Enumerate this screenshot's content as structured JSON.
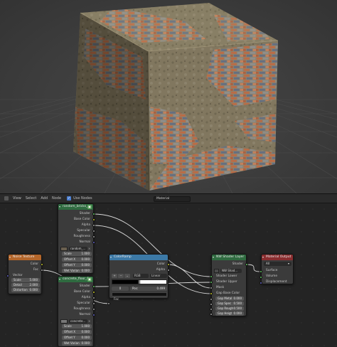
{
  "colors": {
    "viewport_bg": "#3d3d3d",
    "editor_bg": "#242424",
    "node_bg": "#3b3b3b",
    "header_image_texture": "#2f6b40",
    "header_noise_texture": "#b4662a",
    "header_color_ramp": "#3c79a6",
    "header_output": "#8a2d2f",
    "socket_color": "#c7c729",
    "socket_float": "#a1a1a1",
    "socket_shader": "#63c763",
    "socket_vector": "#6363c7"
  },
  "header": {
    "menu": [
      "View",
      "Select",
      "Add",
      "Node"
    ],
    "use_nodes_label": "Use Nodes",
    "material_name": "Material"
  },
  "nodes": {
    "image1": {
      "title": "random_bricks_...",
      "outputs": [
        "Shader",
        "Base Color",
        "Alpha",
        "Specular",
        "Roughness",
        "Normal"
      ],
      "image_name": "random_...",
      "fields": [
        {
          "label": "Scale",
          "value": "1.000"
        },
        {
          "label": "Offset X",
          "value": "0.000"
        },
        {
          "label": "Offset Y",
          "value": "0.000"
        },
        {
          "label": "Wet Varian",
          "value": "0.000"
        }
      ]
    },
    "noise": {
      "title": "Noise Texture",
      "outputs": [
        "Color",
        "Fac"
      ],
      "input_label": "Vector",
      "fields": [
        {
          "label": "Scale",
          "value": "5.000"
        },
        {
          "label": "Detail",
          "value": "2.000"
        },
        {
          "label": "Distortion",
          "value": "0.000"
        }
      ]
    },
    "image2": {
      "title": "concrete_floor_0...",
      "outputs": [
        "Shader",
        "Base Color",
        "Alpha",
        "Specular",
        "Roughness",
        "Normal"
      ],
      "image_name": "concrete...",
      "fields": [
        {
          "label": "Scale",
          "value": "1.000"
        },
        {
          "label": "Offset X",
          "value": "0.000"
        },
        {
          "label": "Offset Y",
          "value": "0.000"
        },
        {
          "label": "Wet Varian",
          "value": "0.000"
        }
      ]
    },
    "ramp": {
      "title": "ColorRamp",
      "outputs": [
        "Color",
        "Alpha"
      ],
      "tools": [
        "+",
        "−",
        "⌄"
      ],
      "mode_left": "RGB",
      "interpolation": "Linear",
      "stop_index": "0",
      "pos_label": "Pos:",
      "pos_value": "0.499",
      "input_label": "Fac"
    },
    "mixer": {
      "title": "NW Shader Layer",
      "output": "Shader",
      "mode": "NW Shad...",
      "inputs": [
        "Shader Lower",
        "Shader Upper",
        "Mask",
        "Gap Base Color"
      ],
      "fields": [
        {
          "label": "Gap Metal",
          "value": "0.000"
        },
        {
          "label": "Gap Spec",
          "value": "0.500"
        },
        {
          "label": "Gap Rough",
          "value": "0.500"
        },
        {
          "label": "Gap Heigt",
          "value": "0.000"
        }
      ]
    },
    "output": {
      "title": "Material Output",
      "target": "All",
      "inputs": [
        "Surface",
        "Volume",
        "Displacement"
      ]
    }
  }
}
